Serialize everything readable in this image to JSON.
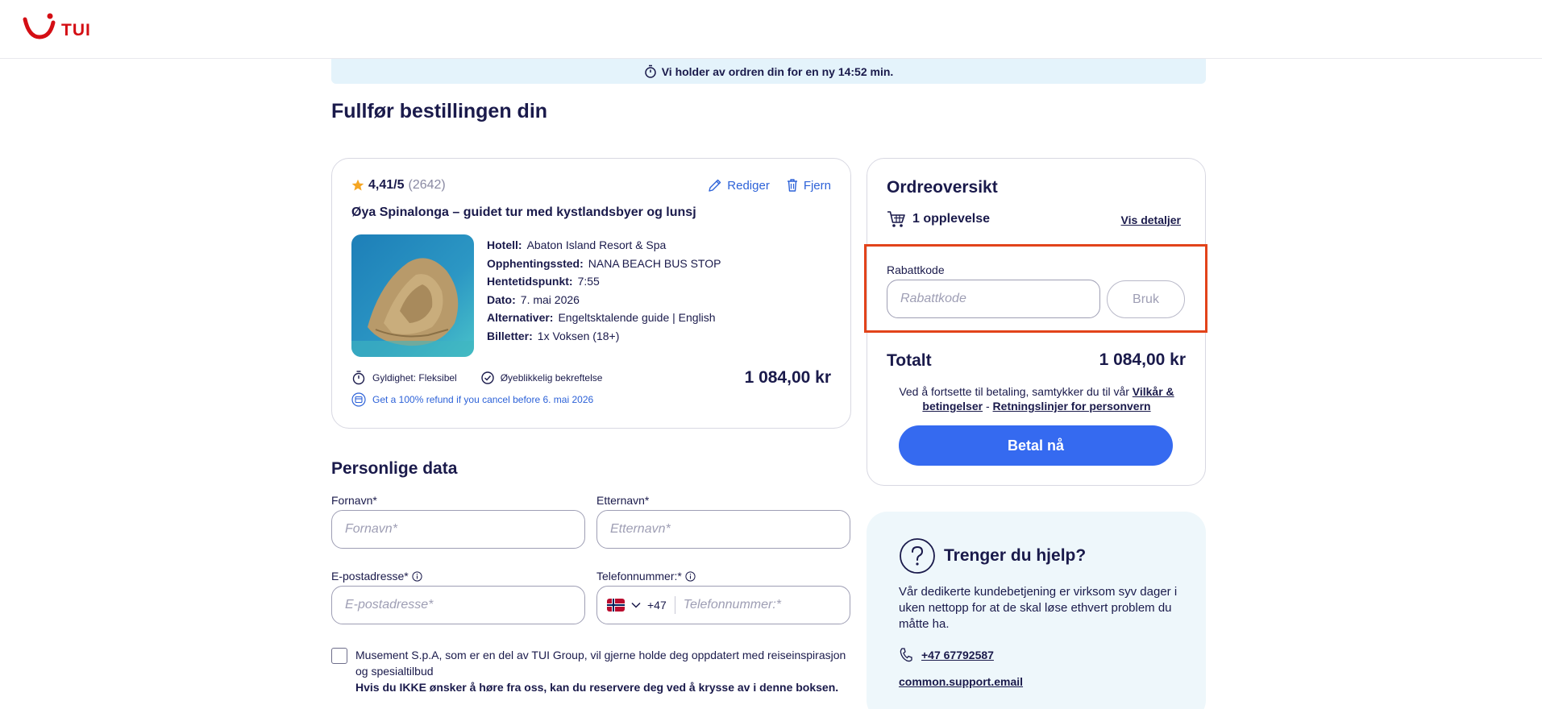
{
  "header": {
    "logo_text": "TUI"
  },
  "timer": {
    "text": "Vi holder av ordren din for en ny 14:52 min."
  },
  "page": {
    "title": "Fullfør bestillingen din"
  },
  "product": {
    "rating_score": "4,41/5",
    "rating_count": "(2642)",
    "edit_label": "Rediger",
    "remove_label": "Fjern",
    "title": "Øya Spinalonga – guidet tur med kystlandsbyer og lunsj",
    "details": [
      {
        "label": "Hotell:",
        "value": "Abaton Island Resort & Spa"
      },
      {
        "label": "Opphentingssted:",
        "value": "NANA BEACH BUS STOP"
      },
      {
        "label": "Hentetidspunkt:",
        "value": "7:55"
      },
      {
        "label": "Dato:",
        "value": "7. mai 2026"
      },
      {
        "label": "Alternativer:",
        "value": "Engeltsktalende guide | English"
      },
      {
        "label": "Billetter:",
        "value": "1x Voksen (18+)"
      }
    ],
    "validity": "Gyldighet: Fleksibel",
    "confirmation": "Øyeblikkelig bekreftelse",
    "refund": "Get a 100% refund if you cancel before 6. mai 2026",
    "price": "1 084,00 kr"
  },
  "order": {
    "title": "Ordreoversikt",
    "count": "1 opplevelse",
    "details_link": "Vis detaljer",
    "discount_label": "Rabattkode",
    "discount_placeholder": "Rabattkode",
    "apply_label": "Bruk",
    "total_label": "Totalt",
    "total_value": "1 084,00 kr",
    "terms_prefix": "Ved å fortsette til betaling, samtykker du til vår",
    "terms_link": "Vilkår & betingelser",
    "terms_sep": "-",
    "privacy_link": "Retningslinjer for personvern",
    "pay_label": "Betal nå"
  },
  "help": {
    "title": "Trenger du hjelp?",
    "text": "Vår dedikerte kundebetjening er virksom syv dager i uken nettopp for at de skal løse ethvert problem du måtte ha.",
    "phone": "+47 67792587",
    "email": "common.support.email"
  },
  "personal": {
    "title": "Personlige data",
    "first_name_label": "Fornavn*",
    "first_name_placeholder": "Fornavn*",
    "last_name_label": "Etternavn*",
    "last_name_placeholder": "Etternavn*",
    "email_label": "E-postadresse*",
    "email_placeholder": "E-postadresse*",
    "phone_label": "Telefonnummer:*",
    "phone_code": "+47",
    "phone_placeholder": "Telefonnummer:*",
    "consent_text": "Musement S.p.A, som er en del av TUI Group, vil gjerne holde deg oppdatert med reiseinspirasjon og spesialtilbud",
    "consent_bold": "Hvis du IKKE ønsker å høre fra oss, kan du reservere deg ved å krysse av i denne boksen."
  },
  "colors": {
    "brand_red": "#d40e14",
    "accent_blue": "#356af0",
    "link_blue": "#2d62d8",
    "navy": "#1a1a4b",
    "highlight": "#e2431a"
  }
}
